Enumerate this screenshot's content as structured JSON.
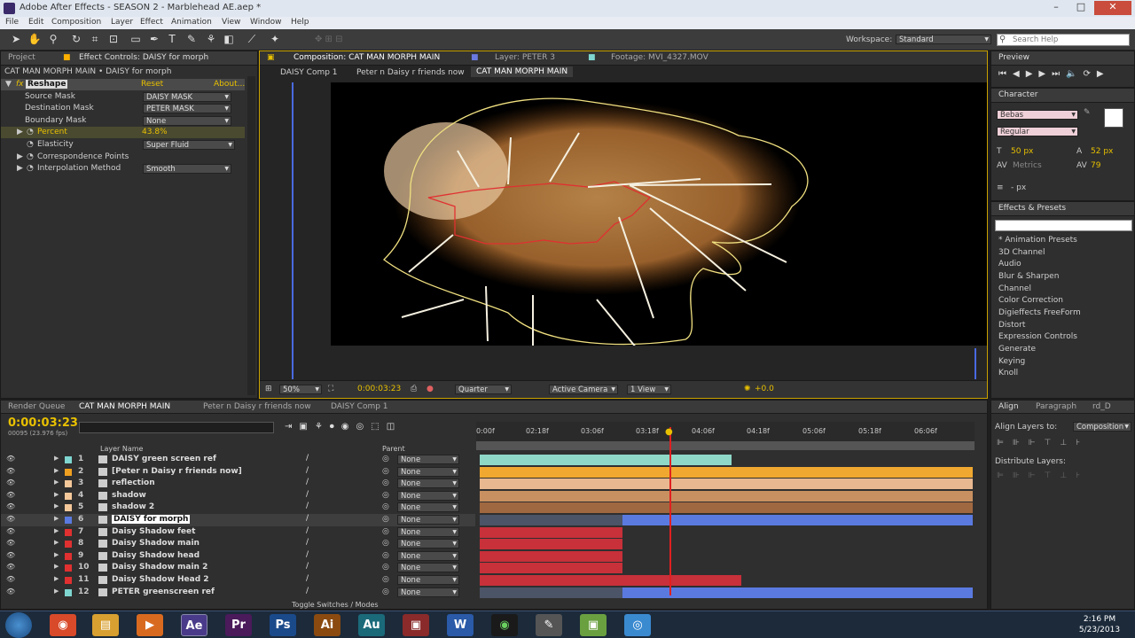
{
  "window": {
    "title": "Adobe After Effects - SEASON 2 - Marblehead AE.aep *"
  },
  "menu": [
    "File",
    "Edit",
    "Composition",
    "Layer",
    "Effect",
    "Animation",
    "View",
    "Window",
    "Help"
  ],
  "workspace": {
    "label": "Workspace:",
    "value": "Standard",
    "search_placeholder": "Search Help"
  },
  "left_panel": {
    "tabs": [
      "Project",
      "Effect Controls: DAISY for morph"
    ],
    "breadcrumb": "CAT MAN MORPH MAIN • DAISY for morph",
    "effect": {
      "name": "Reshape",
      "reset": "Reset",
      "about": "About..."
    },
    "props": [
      {
        "label": "Source Mask",
        "value": "DAISY MASK"
      },
      {
        "label": "Destination Mask",
        "value": "PETER MASK"
      },
      {
        "label": "Boundary Mask",
        "value": "None"
      },
      {
        "label": "Percent",
        "value": "43.8%"
      },
      {
        "label": "Elasticity",
        "value": "Super Fluid"
      },
      {
        "label": "Correspondence Points",
        "value": ""
      },
      {
        "label": "Interpolation Method",
        "value": "Smooth"
      }
    ]
  },
  "comp_panel": {
    "tabs": [
      "Composition: CAT MAN MORPH MAIN",
      "Layer: PETER 3",
      "Footage: MVI_4327.MOV"
    ],
    "breadcrumbs": [
      "DAISY Comp 1",
      "Peter n Daisy r friends now",
      "CAT MAN MORPH MAIN"
    ],
    "bottom": {
      "zoom": "50%",
      "timecode": "0:00:03:23",
      "resolution": "Quarter",
      "camera": "Active Camera",
      "view": "1 View",
      "exposure": "+0.0"
    }
  },
  "preview": {
    "tab": "Preview"
  },
  "character": {
    "tab": "Character",
    "font": "Bebas",
    "style": "Regular",
    "size": "50 px",
    "leading": "52 px",
    "kerning": "Metrics",
    "tracking": "79",
    "stroke": "- px"
  },
  "effects_presets": {
    "tab": "Effects & Presets",
    "items": [
      "* Animation Presets",
      "3D Channel",
      "Audio",
      "Blur & Sharpen",
      "Channel",
      "Color Correction",
      "Digieffects FreeForm",
      "Distort",
      "Expression Controls",
      "Generate",
      "Keying",
      "Knoll"
    ]
  },
  "timeline": {
    "tabs": [
      "Render Queue",
      "CAT MAN MORPH MAIN",
      "Peter n Daisy r friends now",
      "DAISY Comp 1"
    ],
    "timecode": "0:00:03:23",
    "fps": "00095 (23.976 fps)",
    "col_layer": "Layer Name",
    "col_parent": "Parent",
    "ruler": [
      "0:00f",
      "02:18f",
      "03:06f",
      "03:18f",
      "04:06f",
      "04:18f",
      "05:06f",
      "05:18f",
      "06:06f"
    ],
    "toggle": "Toggle Switches / Modes",
    "layers": [
      {
        "n": "1",
        "name": "DAISY green screen ref",
        "parent": "None",
        "color": "#7fd6d0",
        "bar": "#8fd8c8",
        "start": 0,
        "end": 0.51
      },
      {
        "n": "2",
        "name": "[Peter n Daisy r friends now]",
        "parent": "None",
        "color": "#f0a020",
        "bar": "#f0a830",
        "start": 0,
        "end": 1
      },
      {
        "n": "3",
        "name": "reflection",
        "parent": "None",
        "color": "#f5c89a",
        "bar": "#e8b890",
        "start": 0,
        "end": 1
      },
      {
        "n": "4",
        "name": "shadow",
        "parent": "None",
        "color": "#f5c89a",
        "bar": "#c89060",
        "start": 0,
        "end": 1
      },
      {
        "n": "5",
        "name": "shadow 2",
        "parent": "None",
        "color": "#f5c89a",
        "bar": "#a06840",
        "start": 0,
        "end": 1
      },
      {
        "n": "6",
        "name": "DAISY for morph",
        "parent": "None",
        "color": "#5a7ae0",
        "bar": "#5a7ae0",
        "start": 0.29,
        "end": 1
      },
      {
        "n": "7",
        "name": "Daisy Shadow feet",
        "parent": "None",
        "color": "#e03030",
        "bar": "#c8303a",
        "start": 0,
        "end": 0.29
      },
      {
        "n": "8",
        "name": "Daisy Shadow main",
        "parent": "None",
        "color": "#e03030",
        "bar": "#c8303a",
        "start": 0,
        "end": 0.29
      },
      {
        "n": "9",
        "name": "Daisy Shadow head",
        "parent": "None",
        "color": "#e03030",
        "bar": "#c8303a",
        "start": 0,
        "end": 0.29
      },
      {
        "n": "10",
        "name": "Daisy Shadow main 2",
        "parent": "None",
        "color": "#e03030",
        "bar": "#c8303a",
        "start": 0,
        "end": 0.29
      },
      {
        "n": "11",
        "name": "Daisy Shadow Head 2",
        "parent": "None",
        "color": "#e03030",
        "bar": "#c8303a",
        "start": 0,
        "end": 0.53
      },
      {
        "n": "12",
        "name": "PETER greenscreen ref",
        "parent": "None",
        "color": "#7fd6d0",
        "bar": "#5a7ae0",
        "start": 0.29,
        "end": 1
      }
    ]
  },
  "align": {
    "tabs": [
      "Align",
      "Paragraph",
      "rd_D"
    ],
    "label": "Align Layers to:",
    "value": "Composition",
    "distribute": "Distribute Layers:"
  },
  "taskbar": {
    "time": "2:16 PM",
    "date": "5/23/2013"
  }
}
